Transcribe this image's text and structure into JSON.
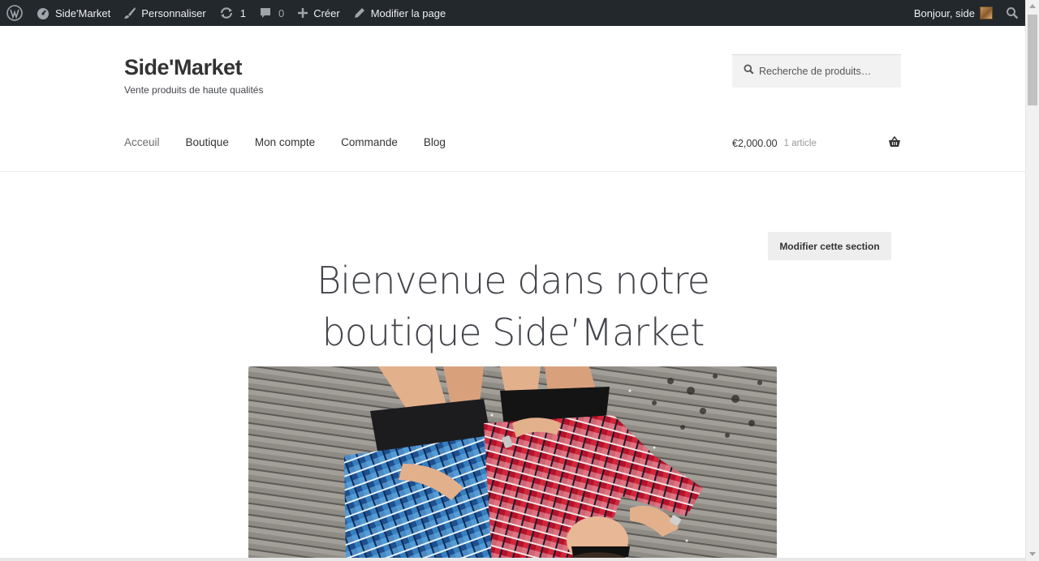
{
  "admin_bar": {
    "site_name": "Side'Market",
    "customize": "Personnaliser",
    "updates_count": "1",
    "comments_count": "0",
    "new_label": "Créer",
    "edit_page": "Modifier la page",
    "greeting": "Bonjour, side",
    "icons": [
      "wordpress-logo-icon",
      "dashboard-icon",
      "brush-icon",
      "updates-icon",
      "comment-icon",
      "plus-icon",
      "pencil-icon",
      "search-icon"
    ]
  },
  "header": {
    "site_title": "Side'Market",
    "tagline": "Vente produits de haute qualités",
    "search_placeholder": "Recherche de produits…"
  },
  "nav": {
    "items": [
      {
        "label": "Acceuil",
        "current": true
      },
      {
        "label": "Boutique"
      },
      {
        "label": "Mon compte"
      },
      {
        "label": "Commande"
      },
      {
        "label": "Blog"
      }
    ]
  },
  "cart": {
    "amount": "€2,000.00",
    "count": "1 article",
    "icon": "basket-icon"
  },
  "hero": {
    "edit_button": "Modifier cette section",
    "title_line1": "Bienvenue dans notre",
    "title_line2": "boutique Side’Market",
    "image_alt": "Two people in plaid shirts lying on wooden deck"
  },
  "colors": {
    "admin_bar_bg": "#23282d",
    "text": "#43454b",
    "title": "#333333",
    "search_bg": "#f2f2f2",
    "button_bg": "#eeeeee"
  }
}
